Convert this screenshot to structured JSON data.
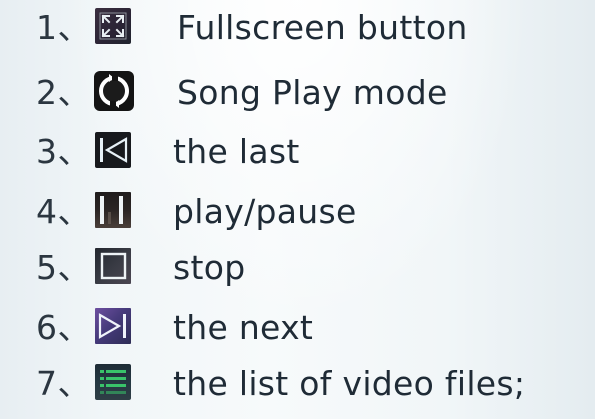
{
  "items": [
    {
      "number": "1、",
      "icon": "fullscreen-icon",
      "label": "Fullscreen button"
    },
    {
      "number": "2、",
      "icon": "repeat-icon",
      "label": "Song Play mode"
    },
    {
      "number": "3、",
      "icon": "skip-previous-icon",
      "label": "the last"
    },
    {
      "number": "4、",
      "icon": "pause-icon",
      "label": "play/pause"
    },
    {
      "number": "5、",
      "icon": "stop-icon",
      "label": "stop"
    },
    {
      "number": "6、",
      "icon": "skip-next-icon",
      "label": "the next"
    },
    {
      "number": "7、",
      "icon": "list-icon",
      "label": "the list of video files;"
    }
  ],
  "colors": {
    "text": "#1f2b36",
    "background": "#f1f6f8",
    "icon_dark": "#17191d",
    "icon_accent_purple": "#463a7b",
    "icon_accent_green": "#39c36a"
  }
}
